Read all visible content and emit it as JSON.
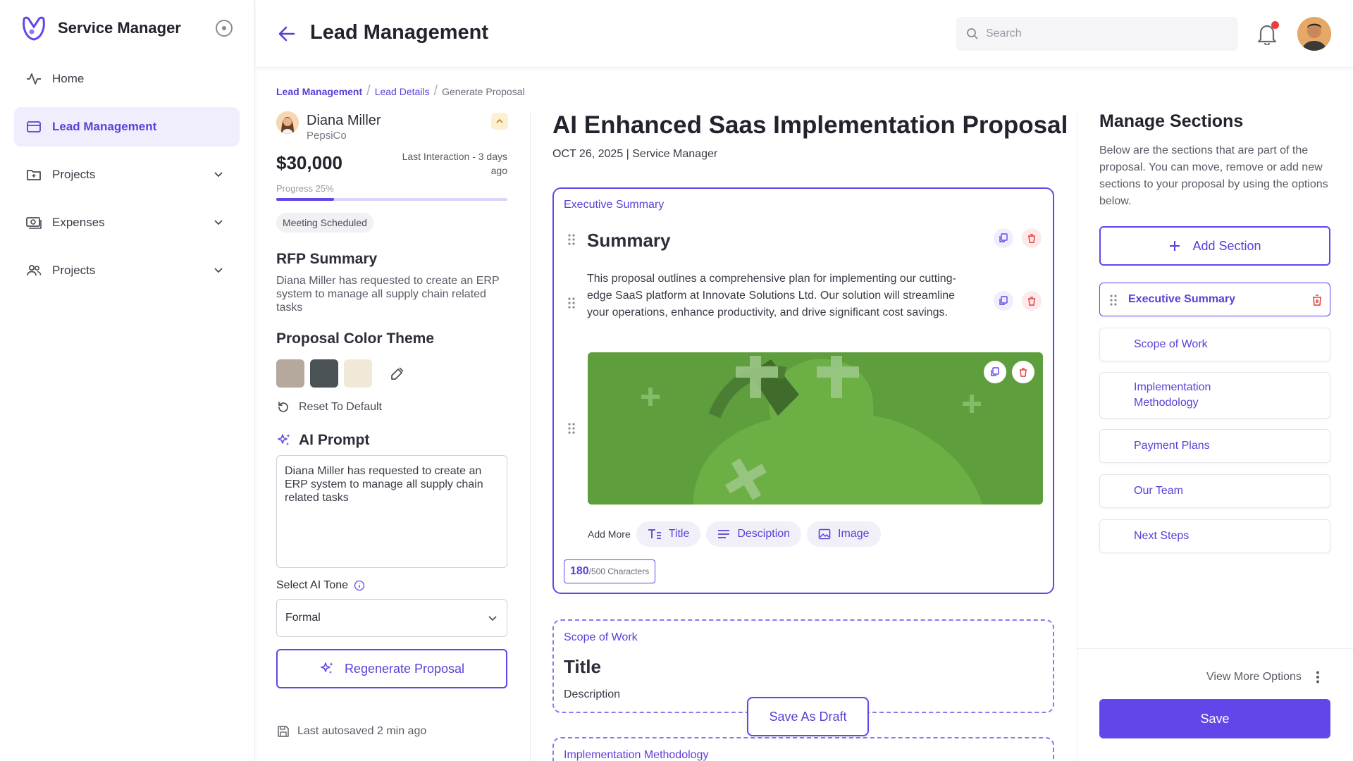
{
  "app": {
    "title": "Service Manager"
  },
  "sidebar": {
    "items": [
      {
        "label": "Home"
      },
      {
        "label": "Lead Management"
      },
      {
        "label": "Projects"
      },
      {
        "label": "Expenses"
      },
      {
        "label": "Projects"
      }
    ]
  },
  "header": {
    "title": "Lead Management",
    "search_placeholder": "Search"
  },
  "breadcrumb": [
    "Lead Management",
    "Lead Details",
    "Generate Proposal"
  ],
  "lead": {
    "name": "Diana Miller",
    "company": "PepsiCo",
    "amount": "$30,000",
    "last_interaction": "Last Interaction - 3 days ago",
    "progress_label": "Progress 25%",
    "progress": 0.25,
    "status": "Meeting Scheduled"
  },
  "rfp": {
    "heading": "RFP Summary",
    "text": "Diana Miller has requested to create an ERP system to manage all supply chain related tasks"
  },
  "theme": {
    "heading": "Proposal Color Theme",
    "swatches": [
      "#b5a89c",
      "#4a5256",
      "#f0e9d8"
    ],
    "reset_label": "Reset To Default"
  },
  "ai": {
    "heading": "AI Prompt",
    "prompt": "Diana Miller has requested to create an ERP system to manage all supply chain related tasks",
    "tone_label": "Select AI Tone",
    "tone_value": "Formal",
    "regenerate_label": "Regenerate Proposal",
    "autosave": "Last autosaved 2 min ago"
  },
  "proposal": {
    "title": "AI Enhanced Saas Implementation Proposal",
    "meta": "OCT 26, 2025 | Service Manager",
    "executive": {
      "label": "Executive Summary",
      "title": "Summary",
      "text": "This proposal outlines a comprehensive plan for implementing our cutting-edge SaaS platform at Innovate Solutions Ltd. Our solution will streamline your operations, enhance productivity, and drive significant cost savings.",
      "add_more": "Add More",
      "chips": [
        "Title",
        "Desciption",
        "Image"
      ],
      "count": "180",
      "count_suffix": "/500 Characters"
    },
    "scope": {
      "label": "Scope of Work",
      "title": "Title",
      "description": "Description"
    },
    "implementation": {
      "label": "Implementation Methodology"
    },
    "draft_label": "Save As Draft"
  },
  "manage": {
    "title": "Manage Sections",
    "desc": "Below are the sections that are part of the proposal. You can move, remove or add new sections to your proposal by using the options below.",
    "add_label": "Add Section",
    "sections": [
      "Executive Summary",
      "Scope of Work",
      "Implementation Methodology",
      "Payment Plans",
      "Our Team",
      "Next Steps"
    ],
    "more_label": "View More Options",
    "save_label": "Save"
  }
}
